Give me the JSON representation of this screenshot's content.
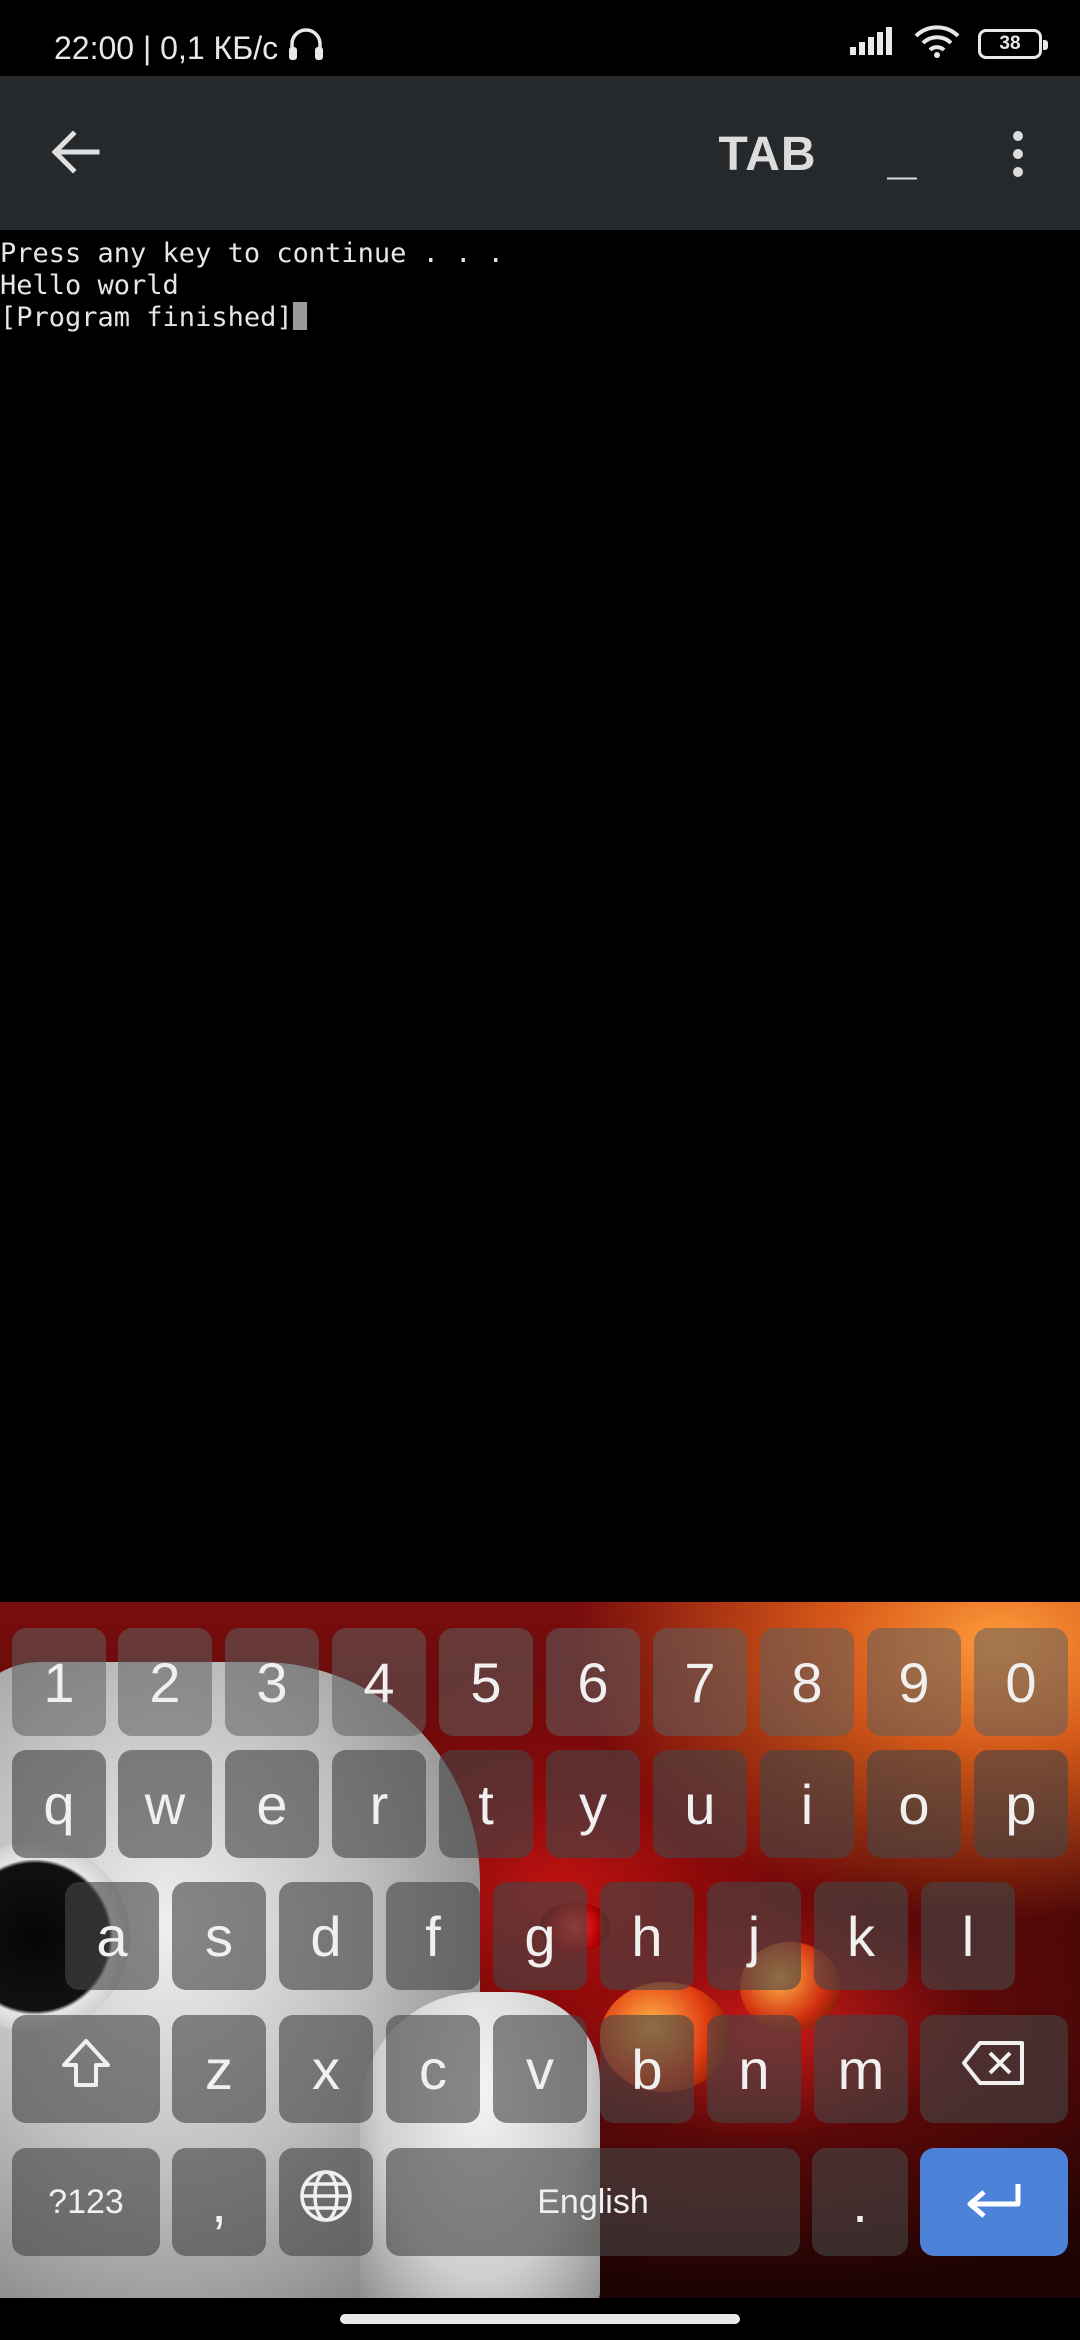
{
  "status_bar": {
    "time_and_speed": "22:00 | 0,1 КБ/с",
    "battery_level": "38",
    "icons": [
      "headphones-icon",
      "signal-icon",
      "wifi-icon",
      "battery-icon"
    ]
  },
  "toolbar": {
    "back_icon": "back-arrow-icon",
    "tab_label": "TAB",
    "underscore_label": "_",
    "menu_icon": "more-vert-icon"
  },
  "terminal": {
    "lines": [
      "Press any key to continue . . .",
      "Hello world",
      "[Program finished]"
    ]
  },
  "keyboard": {
    "number_row": [
      "1",
      "2",
      "3",
      "4",
      "5",
      "6",
      "7",
      "8",
      "9",
      "0"
    ],
    "row1": [
      "q",
      "w",
      "e",
      "r",
      "t",
      "y",
      "u",
      "i",
      "o",
      "p"
    ],
    "row2": [
      "a",
      "s",
      "d",
      "f",
      "g",
      "h",
      "j",
      "k",
      "l"
    ],
    "row3": [
      "z",
      "x",
      "c",
      "v",
      "b",
      "n",
      "m"
    ],
    "symbols_label": "?123",
    "comma_label": ",",
    "space_label": "English",
    "period_label": ".",
    "shift_icon": "shift-icon",
    "globe_icon": "globe-icon",
    "backspace_icon": "backspace-icon",
    "enter_icon": "enter-icon",
    "accent_color": "#4c83d8"
  }
}
